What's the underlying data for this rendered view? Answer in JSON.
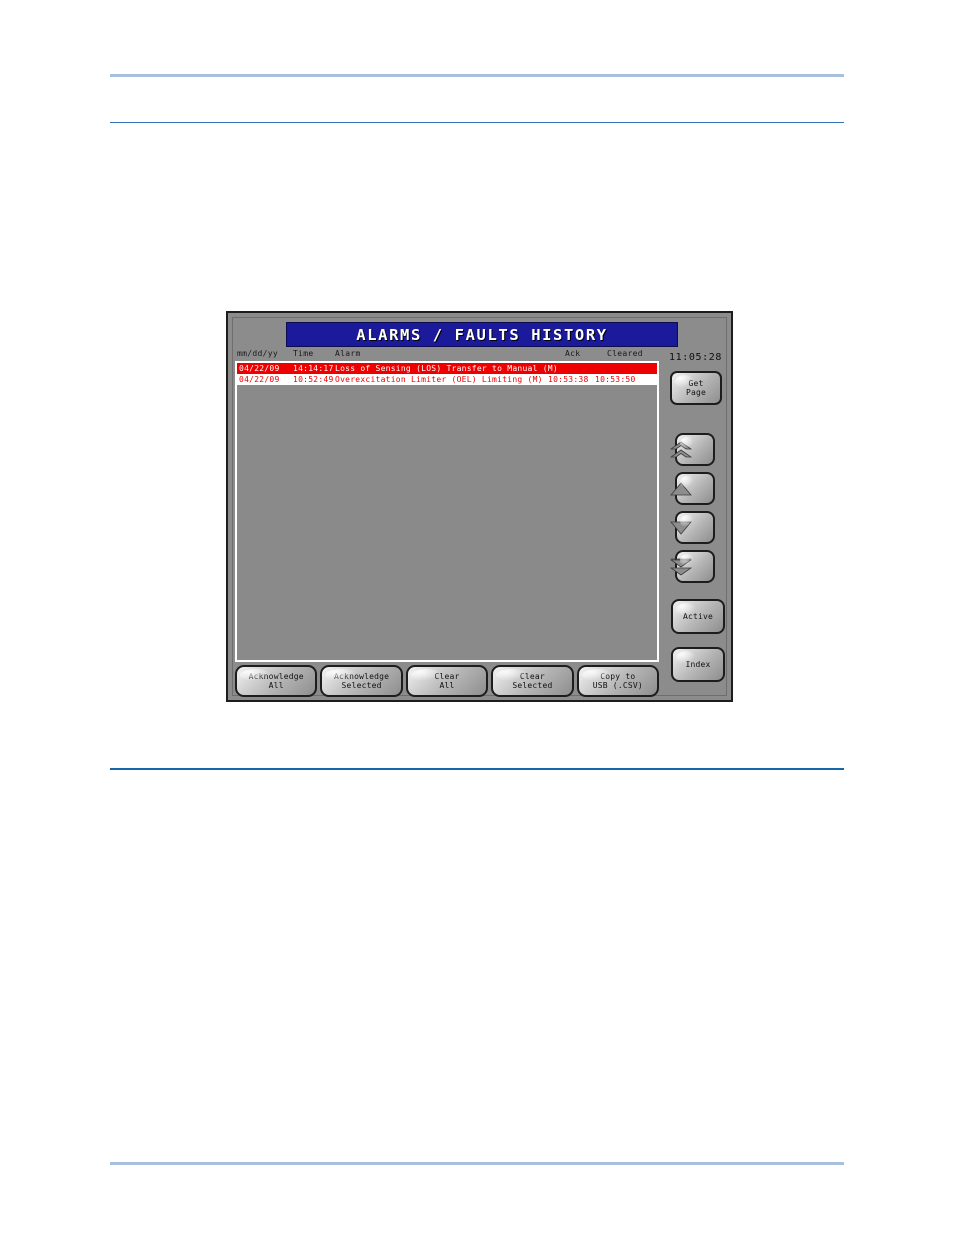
{
  "page": {
    "rules": [
      "top-thick",
      "top-thin",
      "middle",
      "bottom"
    ]
  },
  "device": {
    "title": "ALARMS / FAULTS HISTORY",
    "clock": "11:05:28",
    "columns": {
      "date": "mm/dd/yy",
      "time": "Time",
      "alarm": "Alarm",
      "ack": "Ack",
      "cleared": "Cleared"
    },
    "rows": [
      {
        "date": "04/22/09",
        "time": "14:14:17",
        "text": "Loss of Sensing (LOS) Transfer to Manual (M)",
        "ack": "",
        "cleared": "",
        "state": "active"
      },
      {
        "date": "04/22/09",
        "time": "10:52:49",
        "text": "Overexcitation Limiter (OEL) Limiting (M)",
        "ack": "10:53:38",
        "cleared": "10:53:50",
        "state": "cleared"
      }
    ],
    "buttons": {
      "acknowledge_all": "Acknowledge\nAll",
      "acknowledge_selected": "Acknowledge\nSelected",
      "clear_all": "Clear\nAll",
      "clear_selected": "Clear\nSelected",
      "copy_usb": "Copy to\nUSB (.CSV)",
      "get_page": "Get\nPage",
      "active": "Active",
      "index": "Index"
    },
    "nav_icons": {
      "first": "double-up-arrow-icon",
      "prev": "up-arrow-icon",
      "next": "down-arrow-icon",
      "last": "double-down-arrow-icon"
    },
    "colors": {
      "title_bg": "#1a1a9b",
      "panel_bg": "#8c8c8c",
      "alarm_active_bg": "#ee0000",
      "alarm_cleared_bg": "#ffffff",
      "alarm_cleared_fg": "#ee0000",
      "rule_light": "#a8c0dd",
      "rule_dark": "#1767a8"
    }
  }
}
